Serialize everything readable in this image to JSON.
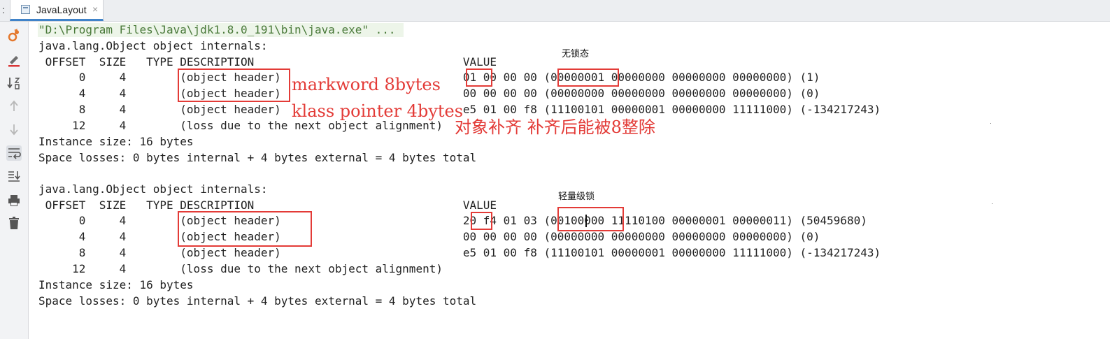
{
  "tabbar": {
    "prefix": ":",
    "tab_label": "JavaLayout",
    "tab_close": "×",
    "tab_icon": "file-icon"
  },
  "toolbar": {
    "icons": [
      "rerun-icon",
      "edit-config-icon",
      "sort-icon",
      "up-arrow-icon",
      "down-arrow-icon",
      "soft-wrap-icon",
      "scroll-to-end-icon",
      "print-icon",
      "trash-icon"
    ],
    "active": "soft-wrap-icon"
  },
  "console": {
    "command": "\"D:\\Program Files\\Java\\jdk1.8.0_191\\bin\\java.exe\" ...",
    "block1": {
      "title": "java.lang.Object object internals:",
      "header": " OFFSET  SIZE   TYPE DESCRIPTION                               VALUE",
      "rows": [
        "      0     4        (object header)                           01 00 00 00 (00000001 00000000 00000000 00000000) (1)",
        "      4     4        (object header)                           00 00 00 00 (00000000 00000000 00000000 00000000) (0)",
        "      8     4        (object header)                           e5 01 00 f8 (11100101 00000001 00000000 11111000) (-134217243)",
        "     12     4        (loss due to the next object alignment)"
      ],
      "instance_size": "Instance size: 16 bytes",
      "space_losses": "Space losses: 0 bytes internal + 4 bytes external = 4 bytes total"
    },
    "block2": {
      "title": "java.lang.Object object internals:",
      "header": " OFFSET  SIZE   TYPE DESCRIPTION                               VALUE",
      "rows": [
        "      0     4        (object header)                           20 f4 01 03 (00100000 11110100 00000001 00000011) (50459680)",
        "      4     4        (object header)                           00 00 00 00 (00000000 00000000 00000000 00000000) (0)",
        "      8     4        (object header)                           e5 01 00 f8 (11100101 00000001 00000000 11111000) (-134217243)",
        "     12     4        (loss due to the next object alignment)"
      ],
      "instance_size": "Instance size: 16 bytes",
      "space_losses": "Space losses: 0 bytes internal + 4 bytes external = 4 bytes total"
    }
  },
  "annotations": {
    "markword": "markword 8bytes",
    "klass_pointer": "klass pointer 4bytes",
    "alignment": "对象补齐 补齐后能被8整除",
    "unlocked": "无锁态",
    "lightweight_lock": "轻量级锁",
    "color": "#e33b37"
  }
}
